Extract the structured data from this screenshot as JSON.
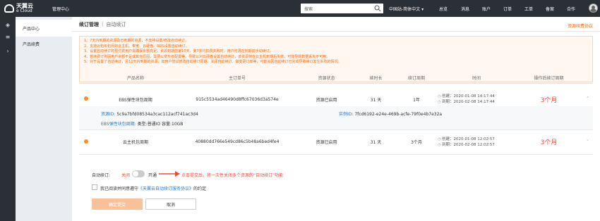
{
  "header": {
    "logo_cn": "天翼云",
    "logo_en": "e Cloud",
    "mgmt_center": "管理中心",
    "search_placeholder": "搜索",
    "region": "中国站-简体中文",
    "nav": [
      "总览",
      "消息",
      "账户",
      "订单",
      "工单",
      "备案",
      "合作"
    ]
  },
  "sidebar": {
    "section": "产品中心",
    "item": "产品续费"
  },
  "breadcrumb": {
    "parent": "续订管理",
    "sep": "|",
    "current": "自动续订"
  },
  "help_link": "资源续费协议",
  "notice": [
    "1、7天内到期的资源及已到期的资源，不支持设置/修改自动续订。",
    "2、支持对包年包月的云主机、带宽、云硬盘、RDS设置自动续订。",
    "3、设置自动续订的预付费用户需确保余额充足，资源到期前第10天、第7天均扣费失败时，用户可再在到期前手动续订。",
    "4、若续费订购因用户余额不足或其他原因，需要以变升级配置等，导致以对云硬盘设置自动续订，该资源将在云主机到期后失效，可能导致数据丢失不可用。",
    "5、对于设置了自动续订，且10天内到期的资源，如用户尝试修改自动续订周期、关闭自动续订、做变更订单等，可能会因自动续订已完成导致续订发生失败的情况。"
  ],
  "table": {
    "headers": [
      "",
      "产品名称",
      "主订单号",
      "资源状态",
      "续时长",
      "续订周期",
      "时间",
      "操作后续订周期",
      ""
    ],
    "rows": [
      {
        "name": "EBS弹性块包周期",
        "order": "915c5534ad46490d8ffc67036d3a574e",
        "status": "资源已启用",
        "duration": "31 天",
        "cycle": "1年",
        "created": "创建：2020-01-08 14:17:44",
        "expire": "到期：2020-02-08 14:17:44",
        "new_period": "3个月",
        "resource_id_label": "资源ID:",
        "resource_id": "5c9a7bfd08534a3cac112acf741ac3d4",
        "instance_id_label": "实例ID:",
        "instance_id": "7fcd6192-e24e-469b-acfe-79f0e4b7e32a",
        "extra_label": "EBS弹性块包周期:",
        "extra_value": "类型:普通IO 容量:10GB"
      },
      {
        "name": "云主机包周期",
        "order": "40880dd766e549cd86c5b48a6bed4fe4",
        "status": "资源已启用",
        "duration": "31 天",
        "cycle": "3个月",
        "created": "创建：2020-01-08 12:02:57",
        "expire": "到期：2020-02-08 12:02:57",
        "new_period": "3个月"
      }
    ]
  },
  "form": {
    "auto_label": "自动续订:",
    "off": "关闭",
    "on": "开通",
    "hint": "点击提交后，将一次性关闭多个资源的“自动续订”功能",
    "agree_prefix": "我已阅读并同意遵守",
    "agree_link": "《天翼云自动续订服务协议》",
    "agree_suffix": "的约定",
    "submit": "确定提交",
    "cancel": "取消"
  },
  "colors": {
    "accent": "#ff6600",
    "dark_bar": "#2b2f36",
    "danger": "#e84c3d",
    "link": "#1a7bd6"
  }
}
